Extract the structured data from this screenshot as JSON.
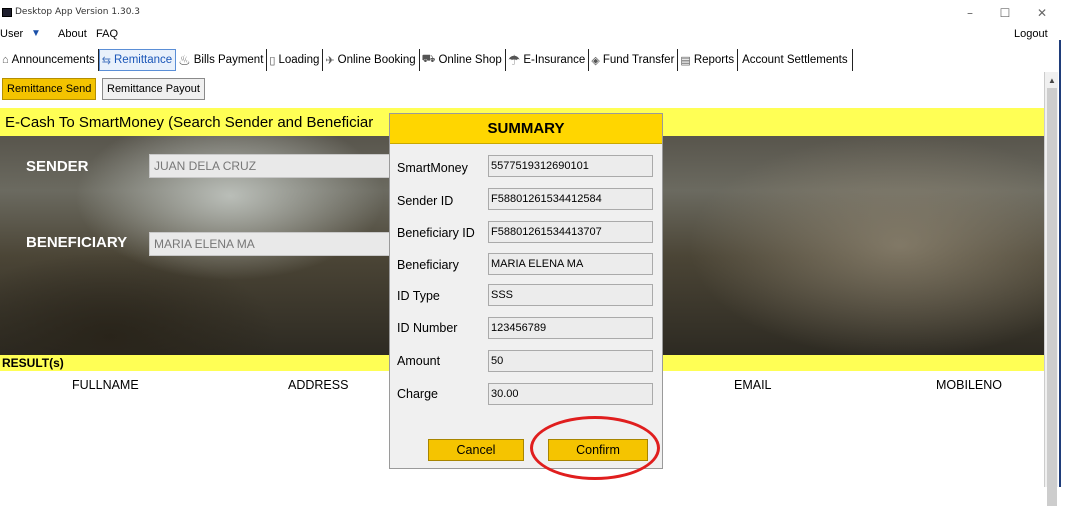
{
  "window": {
    "title": "Desktop App Version 1.30.3",
    "minimize": "–",
    "maximize": "☐",
    "close": "✕"
  },
  "menu": {
    "user": "User",
    "user_arrow": "▼",
    "about": "About",
    "faq": "FAQ",
    "logout": "Logout"
  },
  "nav_tabs": [
    {
      "label": "Announcements",
      "icon": "megaphone-icon"
    },
    {
      "label": "Remittance",
      "icon": "remittance-icon",
      "active": true
    },
    {
      "label": "Bills Payment",
      "icon": "bills-icon"
    },
    {
      "label": "Loading",
      "icon": "phone-icon"
    },
    {
      "label": "Online Booking",
      "icon": "plane-icon"
    },
    {
      "label": "Online Shop",
      "icon": "cart-icon"
    },
    {
      "label": "E-Insurance",
      "icon": "umbrella-icon"
    },
    {
      "label": "Fund Transfer",
      "icon": "money-icon"
    },
    {
      "label": "Reports",
      "icon": "report-icon"
    },
    {
      "label": "Account Settlements",
      "icon": ""
    }
  ],
  "sub_tabs": {
    "send": "Remittance Send",
    "payout": "Remittance Payout"
  },
  "section": {
    "title": "E-Cash To SmartMoney (Search Sender and Beneficiar"
  },
  "form": {
    "sender_label": "SENDER",
    "sender_value": "JUAN DELA CRUZ",
    "beneficiary_label": "BENEFICIARY",
    "beneficiary_value": "MARIA ELENA MA"
  },
  "results": {
    "title": "RESULT(s)",
    "columns": [
      "FULLNAME",
      "ADDRESS",
      "EMAIL",
      "MOBILENO"
    ]
  },
  "summary": {
    "title": "SUMMARY",
    "rows": [
      {
        "label": "SmartMoney",
        "value": "5577519312690101"
      },
      {
        "label": "Sender ID",
        "value": "F58801261534412584"
      },
      {
        "label": "Beneficiary ID",
        "value": "F58801261534413707"
      },
      {
        "label": "Beneficiary",
        "value": "MARIA ELENA MA"
      },
      {
        "label": "ID Type",
        "value": "SSS"
      },
      {
        "label": "ID Number",
        "value": "123456789"
      },
      {
        "label": "Amount",
        "value": "50"
      },
      {
        "label": "Charge",
        "value": "30.00"
      }
    ],
    "cancel": "Cancel",
    "confirm": "Confirm"
  },
  "colors": {
    "accent_yellow": "#ffd600",
    "header_yellow": "#ffff55",
    "highlight_red": "#e01e1e",
    "active_tab_blue": "#1a56b8"
  }
}
